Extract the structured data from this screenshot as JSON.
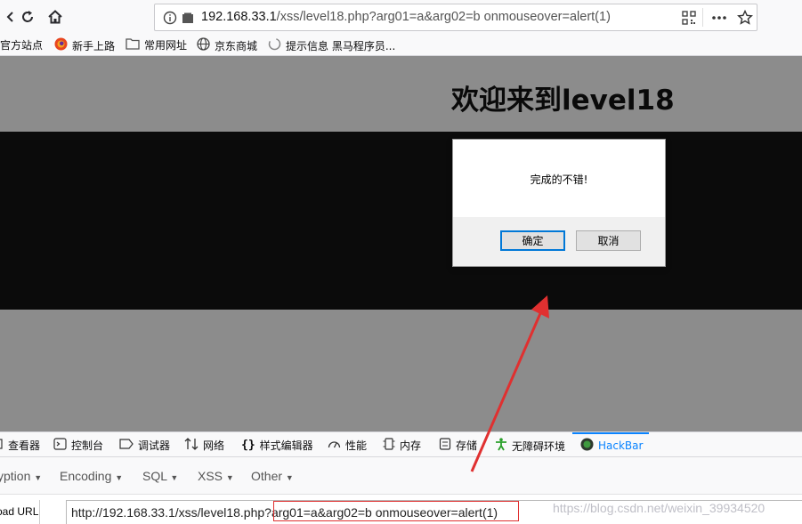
{
  "browser": {
    "url_host": "192.168.33.1",
    "url_rest": "/xss/level18.php?arg01=a&arg02=b onmouseover=alert(1)",
    "bookmarks": [
      {
        "label": "官方站点",
        "icon": "bookmark-icon"
      },
      {
        "label": "新手上路",
        "icon": "firefox-icon"
      },
      {
        "label": "常用网址",
        "icon": "folder-icon"
      },
      {
        "label": "京东商城",
        "icon": "globe-icon"
      },
      {
        "label": "提示信息 黑马程序员...",
        "icon": "loading-icon"
      }
    ]
  },
  "page": {
    "title": "欢迎来到level18"
  },
  "dialog": {
    "message": "完成的不错!",
    "ok_label": "确定",
    "cancel_label": "取消"
  },
  "devtools": {
    "tabs": [
      {
        "label": "查看器",
        "icon": "inspector-icon"
      },
      {
        "label": "控制台",
        "icon": "console-icon"
      },
      {
        "label": "调试器",
        "icon": "debugger-icon"
      },
      {
        "label": "网络",
        "icon": "network-icon"
      },
      {
        "label": "样式编辑器",
        "icon": "style-editor-icon"
      },
      {
        "label": "性能",
        "icon": "performance-icon"
      },
      {
        "label": "内存",
        "icon": "memory-icon"
      },
      {
        "label": "存储",
        "icon": "storage-icon"
      },
      {
        "label": "无障碍环境",
        "icon": "accessibility-icon"
      },
      {
        "label": "HackBar",
        "icon": "hackbar-icon"
      }
    ],
    "active_tab": "HackBar"
  },
  "hackbar": {
    "menu": [
      "yption",
      "Encoding",
      "SQL",
      "XSS",
      "Other"
    ],
    "load_url_label": "oad URL",
    "url_value": "http://192.168.33.1/xss/level18.php?arg01=a&arg02=b onmouseover=alert(1)"
  },
  "watermark": "https://blog.csdn.net/weixin_39934520",
  "colors": {
    "accent": "#0a84ff",
    "annotation": "#e03030",
    "page_bg": "#8c8c8c",
    "band": "#0b0b0b"
  }
}
